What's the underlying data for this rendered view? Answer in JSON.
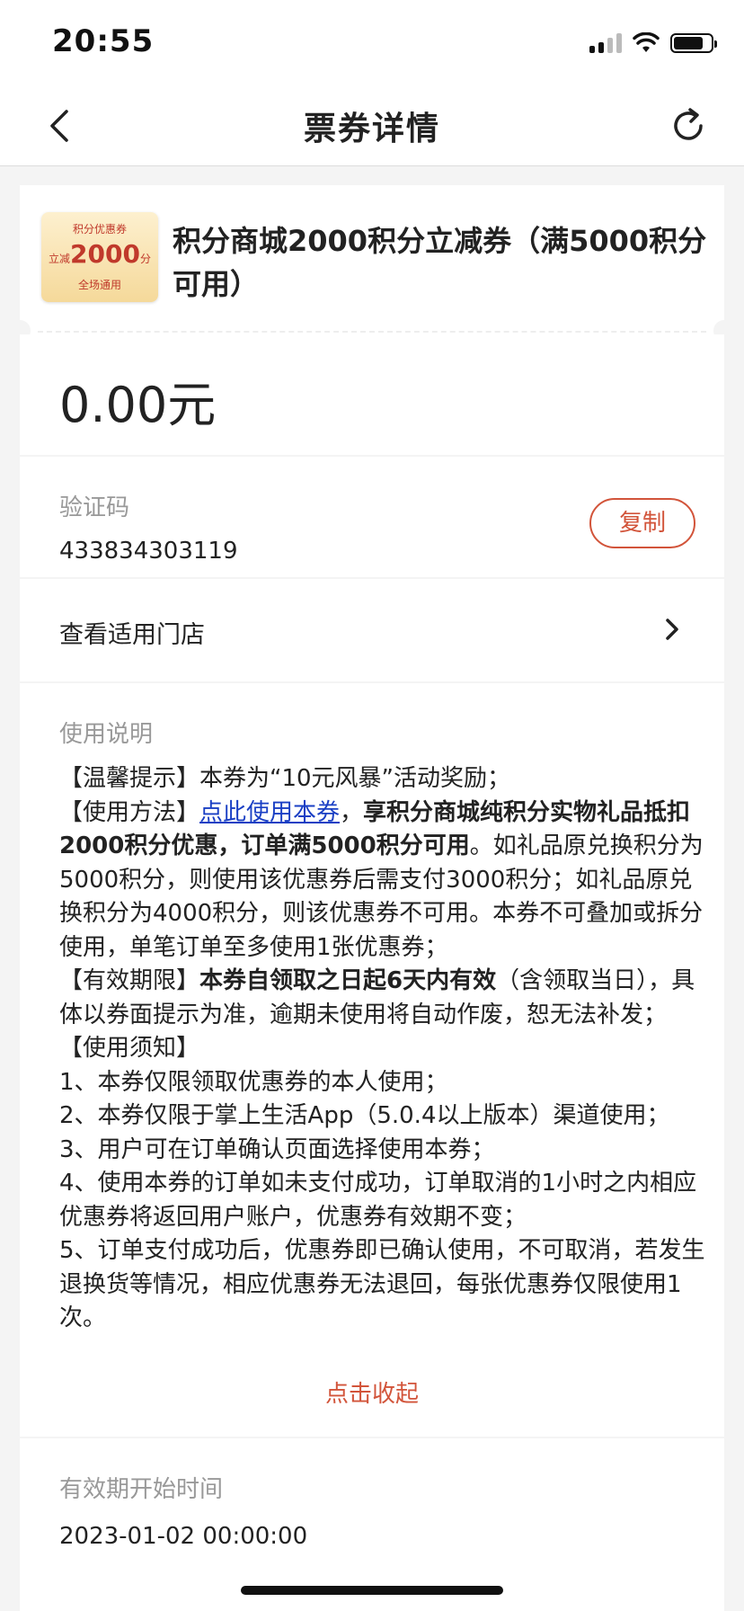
{
  "status_bar": {
    "time": "20:55",
    "battery_level": 0.8
  },
  "nav": {
    "title": "票券详情",
    "back_icon": "chevron-left-icon",
    "refresh_icon": "refresh-icon"
  },
  "coupon": {
    "badge": {
      "top": "积分优惠券",
      "prefix": "立减",
      "amount": "2000",
      "unit": "分",
      "bottom": "全场通用"
    },
    "title": "积分商城2000积分立减券（满5000积分可用）"
  },
  "price": "0.00元",
  "verify": {
    "label": "验证码",
    "code": "433834303119",
    "copy_label": "复制"
  },
  "store": {
    "label": "查看适用门店"
  },
  "usage": {
    "label": "使用说明",
    "tip": "【温馨提示】本券为“10元风暴”活动奖励；",
    "method_prefix": "【使用方法】",
    "method_link": "点此使用本券",
    "method_sep": "，",
    "method_bold": "享积分商城纯积分实物礼品抵扣2000积分优惠，订单满5000积分可用",
    "method_rest": "。如礼品原兑换积分为5000积分，则使用该优惠券后需支付3000积分；如礼品原兑换积分为4000积分，则该优惠券不可用。本券不可叠加或拆分使用，单笔订单至多使用1张优惠券；",
    "period_prefix": "【有效期限】",
    "period_bold": "本券自领取之日起6天内有效",
    "period_rest": "（含领取当日），具体以券面提示为准，逾期未使用将自动作废，恕无法补发；",
    "notice_title": "【使用须知】",
    "notices": [
      "1、本券仅限领取优惠券的本人使用；",
      "2、本券仅限于掌上生活App（5.0.4以上版本）渠道使用；",
      "3、用户可在订单确认页面选择使用本券；",
      "4、使用本券的订单如未支付成功，订单取消的1小时之内相应优惠券将返回用户账户，优惠券有效期不变；",
      "5、订单支付成功后，优惠券即已确认使用，不可取消，若发生退换货等情况，相应优惠券无法退回，每张优惠券仅限使用1次。"
    ],
    "collapse_label": "点击收起"
  },
  "validity": {
    "label": "有效期开始时间",
    "value": "2023-01-02 00:00:00"
  },
  "colors": {
    "accent": "#d2543a",
    "link": "#1a3fc4",
    "background": "#f4f4f4"
  }
}
